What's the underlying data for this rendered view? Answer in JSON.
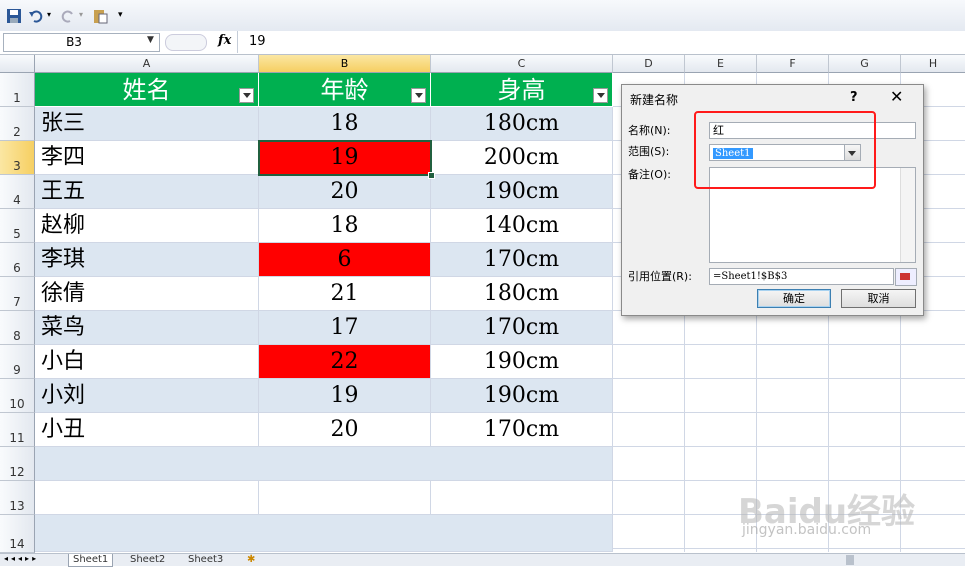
{
  "formula_bar": {
    "name_box": "B3",
    "fx": "fx",
    "value": "19"
  },
  "columns": [
    "A",
    "B",
    "C",
    "D",
    "E",
    "F",
    "G",
    "H"
  ],
  "rows": [
    "1",
    "2",
    "3",
    "4",
    "5",
    "6",
    "7",
    "8",
    "9",
    "10",
    "11",
    "12",
    "13",
    "14"
  ],
  "table": {
    "headers": [
      "姓名",
      "年龄",
      "身高"
    ],
    "rows": [
      [
        "张三",
        "18",
        "180cm"
      ],
      [
        "李四",
        "19",
        "200cm"
      ],
      [
        "王五",
        "20",
        "190cm"
      ],
      [
        "赵柳",
        "18",
        "140cm"
      ],
      [
        "李琪",
        "6",
        "170cm"
      ],
      [
        "徐倩",
        "21",
        "180cm"
      ],
      [
        "菜鸟",
        "17",
        "170cm"
      ],
      [
        "小白",
        "22",
        "190cm"
      ],
      [
        "小刘",
        "19",
        "190cm"
      ],
      [
        "小丑",
        "20",
        "170cm"
      ]
    ],
    "highlight_color": "#ff0000",
    "header_color": "#00b050",
    "band_color": "#dce6f1"
  },
  "sheets": [
    "Sheet1",
    "Sheet2",
    "Sheet3"
  ],
  "dialog": {
    "title": "新建名称",
    "help": "?",
    "close": "✕",
    "name_label": "名称(N):",
    "name_value": "红",
    "scope_label": "范围(S):",
    "scope_value": "Sheet1",
    "comment_label": "备注(O):",
    "ref_label": "引用位置(R):",
    "ref_value": "=Sheet1!$B$3",
    "ok": "确定",
    "cancel": "取消"
  },
  "watermark": {
    "brand": "Baidu经验",
    "url": "jingyan.baidu.com"
  }
}
